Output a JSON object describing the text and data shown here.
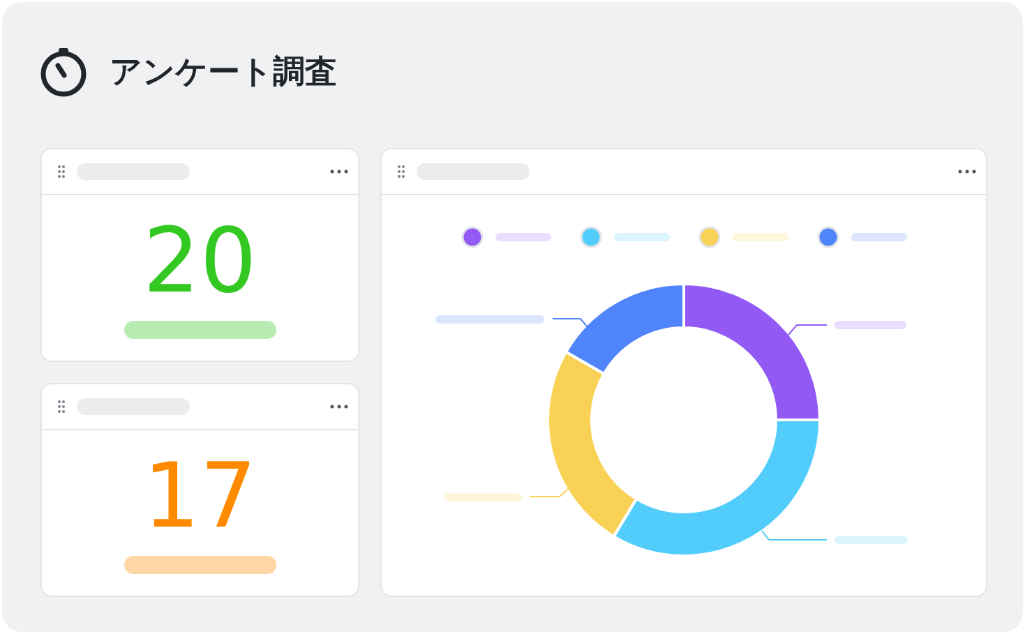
{
  "title": "アンケート調査",
  "stats": [
    {
      "value": "20",
      "color": "#33c822"
    },
    {
      "value": "17",
      "color": "#ff8a00"
    }
  ],
  "legend": [
    {
      "color": "#9259f5"
    },
    {
      "color": "#52cdfb"
    },
    {
      "color": "#f9d255"
    },
    {
      "color": "#4f84fb"
    }
  ]
}
